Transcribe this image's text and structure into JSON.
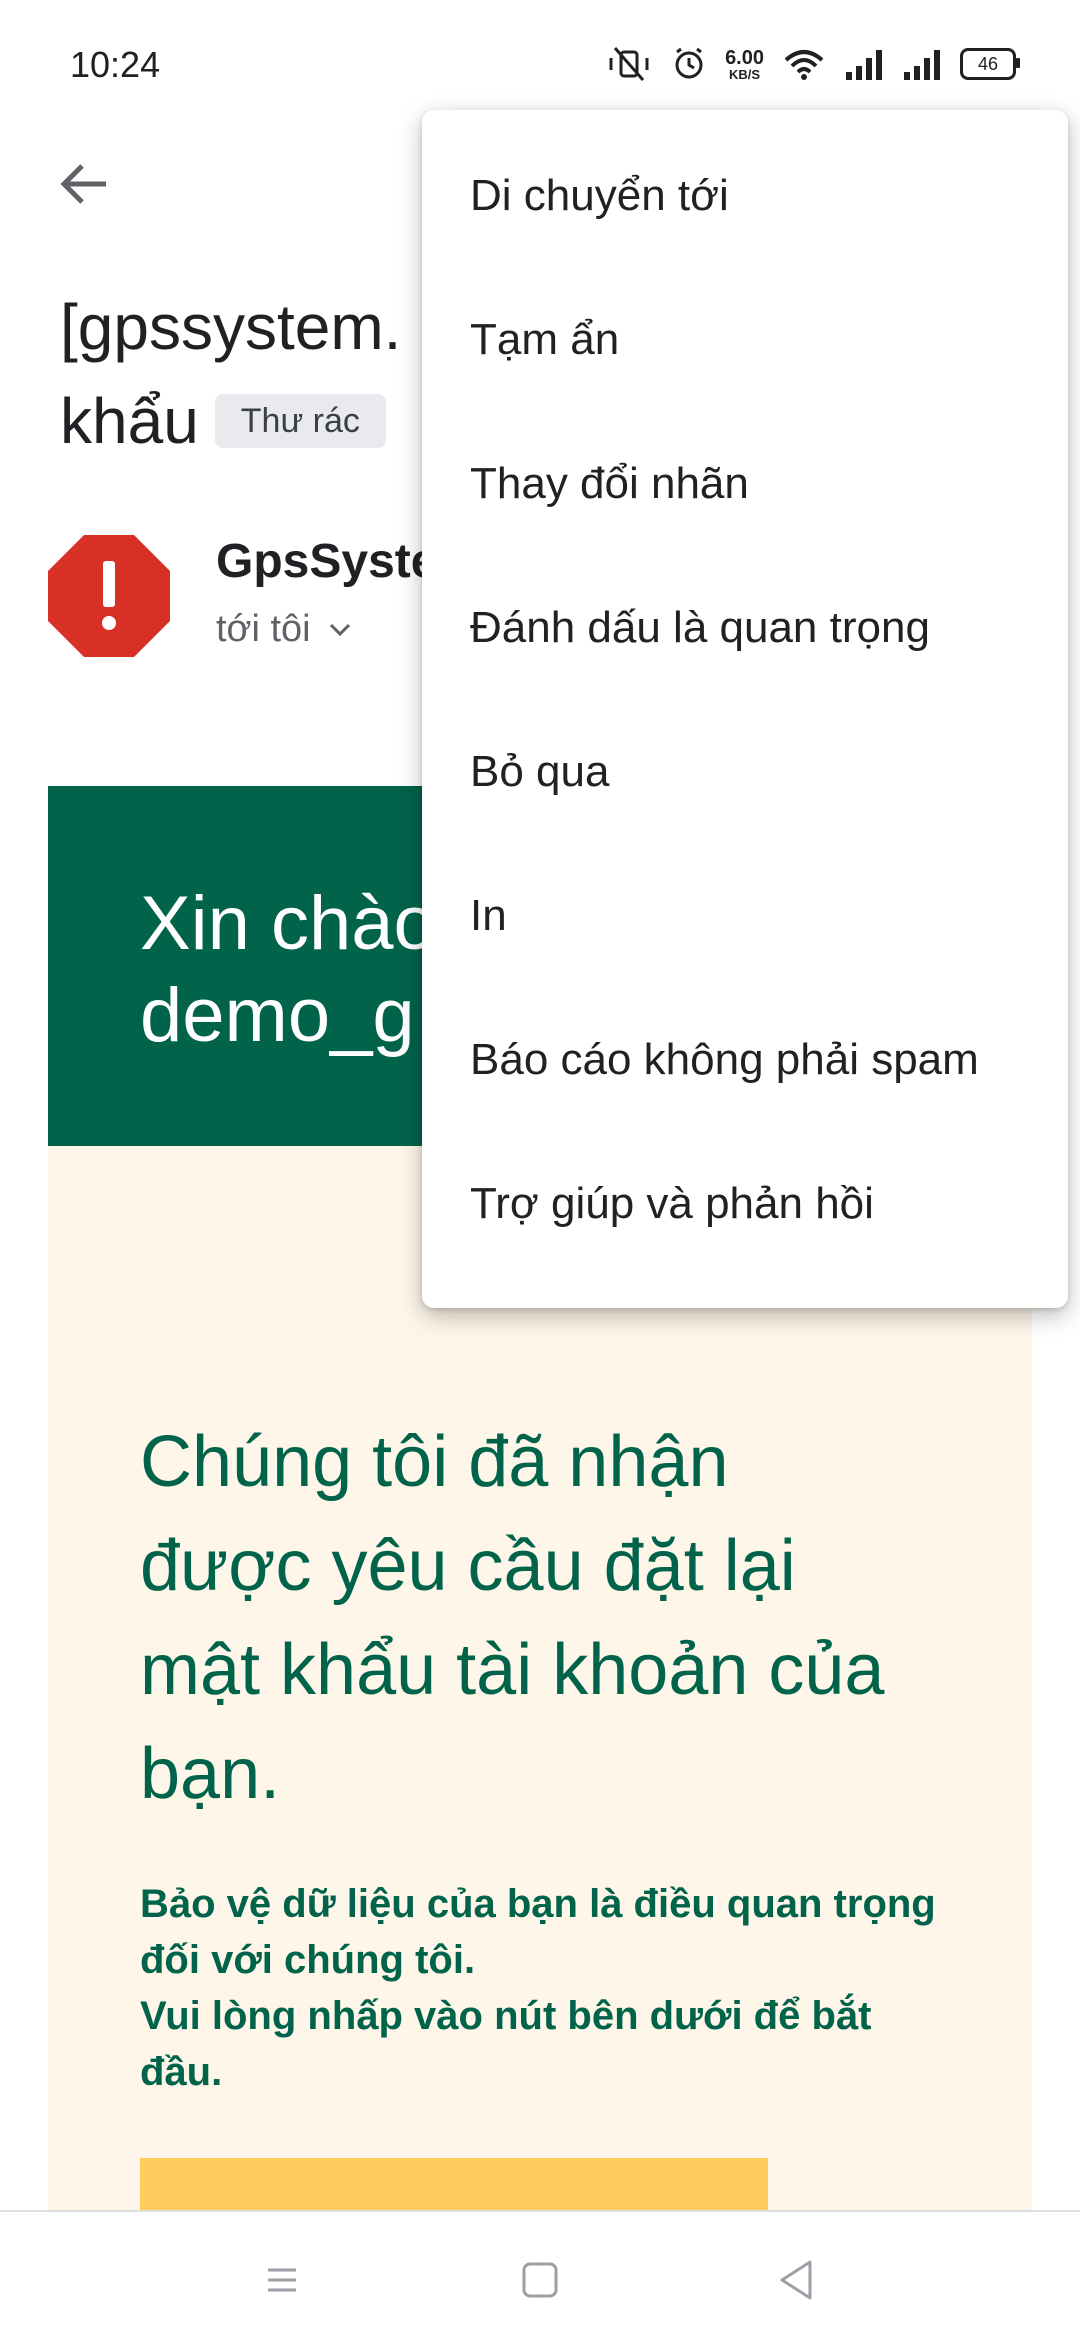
{
  "status_bar": {
    "time": "10:24",
    "net_speed_value": "6.00",
    "net_speed_unit": "KB/S",
    "battery_level": "46"
  },
  "email": {
    "subject_line1": "[gpssystem.",
    "subject_line2": "khẩu",
    "spam_label": "Thư rác",
    "sender_name": "GpsSyste",
    "recipient_label": "tới tôi",
    "greeting": "Xin chào\ndemo_g",
    "heading": "Chúng tôi đã nhận được yêu cầu đặt lại mật khẩu tài khoản của bạn.",
    "body_text_line1": "Bảo vệ dữ liệu của bạn là điều quan trọng đối với chúng tôi.",
    "body_text_line2": "Vui lòng nhấp vào nút bên dưới để bắt đầu."
  },
  "menu": {
    "items": [
      {
        "label": "Di chuyển tới"
      },
      {
        "label": "Tạm ẩn"
      },
      {
        "label": "Thay đổi nhãn"
      },
      {
        "label": "Đánh dấu là quan trọng"
      },
      {
        "label": "Bỏ qua"
      },
      {
        "label": "In"
      },
      {
        "label": "Báo cáo không phải spam"
      },
      {
        "label": "Trợ giúp và phản hồi"
      }
    ]
  },
  "colors": {
    "brand_green": "#00634a",
    "body_cream": "#fdf6e9",
    "cta_yellow": "#fccc5c",
    "spam_red": "#d93025"
  }
}
